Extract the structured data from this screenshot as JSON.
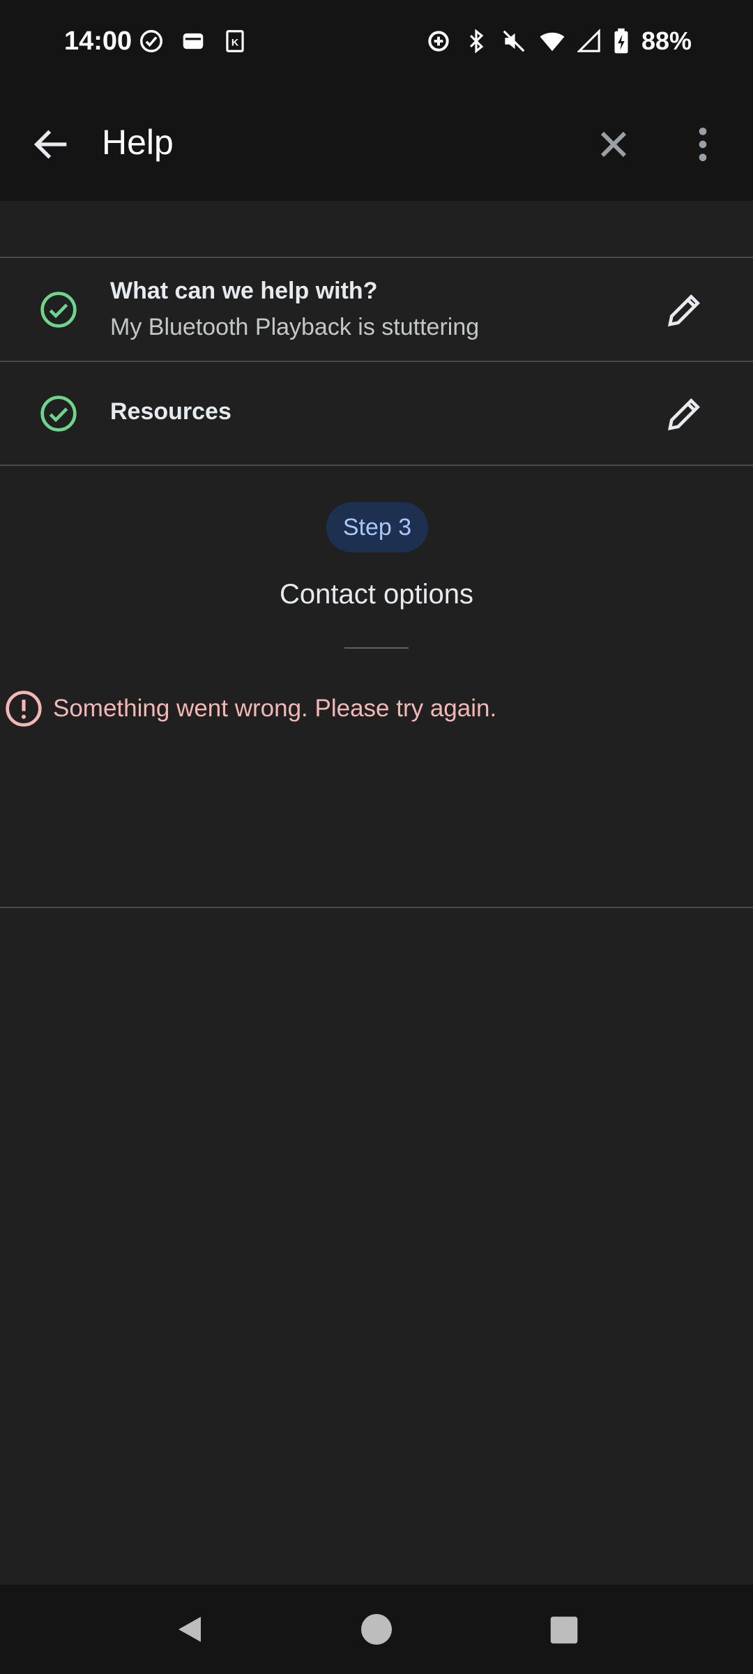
{
  "status_bar": {
    "time": "14:00",
    "battery": "88%",
    "icons": [
      "check-circle-icon",
      "wallet-icon",
      "k-app-icon",
      "data-saver-icon",
      "bluetooth-icon",
      "mute-icon",
      "wifi-icon",
      "signal-icon",
      "battery-charging-icon"
    ]
  },
  "app_bar": {
    "title": "Help",
    "back_icon": "arrow-back-icon",
    "close_icon": "close-icon",
    "more_icon": "more-vert-icon"
  },
  "steps": [
    {
      "title": "What can we help with?",
      "subtitle": "My Bluetooth Playback is stuttering",
      "status": "complete"
    },
    {
      "title": "Resources",
      "subtitle": "",
      "status": "complete"
    }
  ],
  "current_step": {
    "chip": "Step 3",
    "title": "Contact options"
  },
  "error": {
    "message": "Something went wrong. Please try again."
  },
  "colors": {
    "background": "#202020",
    "bar": "#141414",
    "success_green": "#6dd58c",
    "error_text": "#f2b8b5",
    "chip_bg": "#1e3050",
    "chip_text": "#a8c7fa"
  },
  "nav_bar": {
    "icons": [
      "nav-back-icon",
      "nav-home-icon",
      "nav-recents-icon"
    ]
  }
}
